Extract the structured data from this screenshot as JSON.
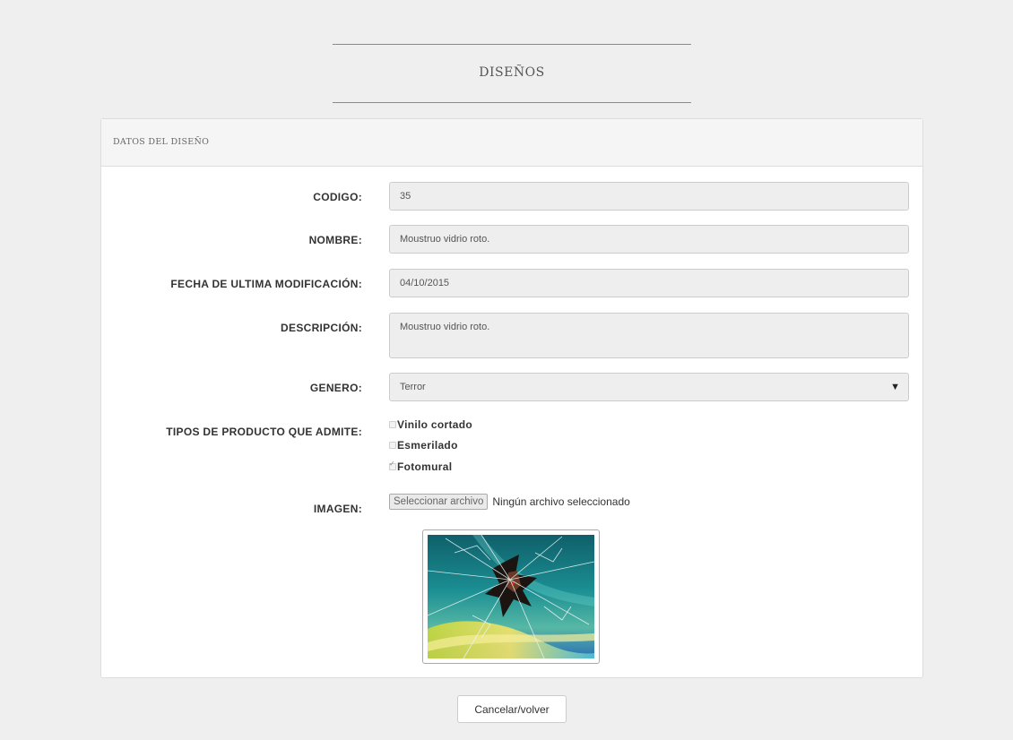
{
  "header": {
    "title": "DISEÑOS"
  },
  "panel": {
    "title": "DATOS DEL DISEÑO",
    "fields": {
      "codigo": {
        "label": "CODIGO:",
        "value": "35"
      },
      "nombre": {
        "label": "NOMBRE:",
        "value": "Moustruo vidrio roto."
      },
      "fecha": {
        "label": "FECHA DE ULTIMA MODIFICACIÓN:",
        "value": "04/10/2015"
      },
      "descripcion": {
        "label": "DESCRIPCIÓN:",
        "value": "Moustruo vidrio roto."
      },
      "genero": {
        "label": "GENERO:",
        "value": "Terror"
      },
      "tipos": {
        "label": "TIPOS DE PRODUCTO QUE ADMITE:",
        "options": [
          {
            "label": "Vinilo cortado",
            "checked": false
          },
          {
            "label": "Esmerilado",
            "checked": false
          },
          {
            "label": "Fotomural",
            "checked": true
          }
        ]
      },
      "imagen": {
        "label": "IMAGEN:",
        "button_label": "Seleccionar archivo",
        "status": "Ningún archivo seleccionado"
      }
    }
  },
  "footer": {
    "cancel_label": "Cancelar/volver"
  },
  "icons": {
    "select_arrow": "caret-down-icon",
    "checkbox_mark": "check-icon"
  }
}
